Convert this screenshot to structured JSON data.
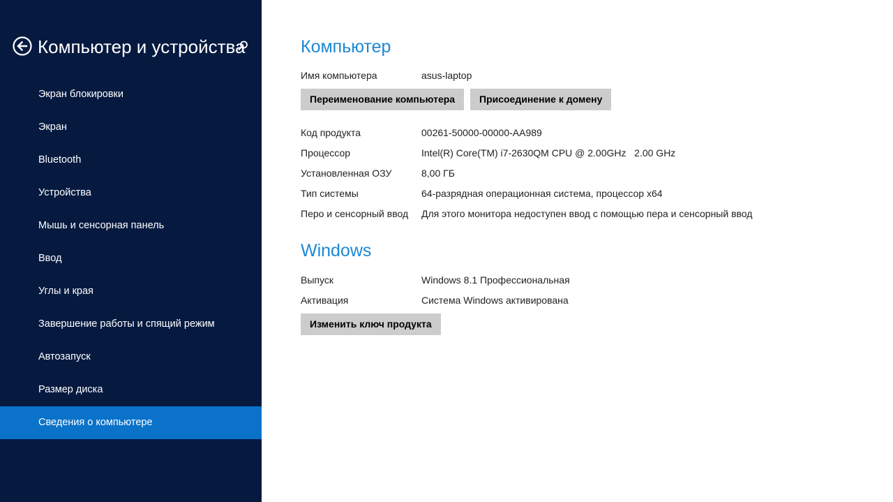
{
  "sidebar": {
    "title": "Компьютер и устройства",
    "back_icon": "back-arrow-icon",
    "search_icon": "search-icon",
    "items": [
      {
        "label": "Экран блокировки"
      },
      {
        "label": "Экран"
      },
      {
        "label": "Bluetooth"
      },
      {
        "label": "Устройства"
      },
      {
        "label": "Мышь и сенсорная панель"
      },
      {
        "label": "Ввод"
      },
      {
        "label": "Углы и края"
      },
      {
        "label": "Завершение работы и спящий режим"
      },
      {
        "label": "Автозапуск"
      },
      {
        "label": "Размер диска"
      },
      {
        "label": "Сведения о компьютере",
        "selected": true
      }
    ]
  },
  "computer": {
    "heading": "Компьютер",
    "name_label": "Имя компьютера",
    "name_value": "asus-laptop",
    "rename_button": "Переименование компьютера",
    "join_domain_button": "Присоединение к домену",
    "specs": [
      {
        "label": "Код продукта",
        "value": "00261-50000-00000-AA989"
      },
      {
        "label": "Процессор",
        "value": "Intel(R) Core(TM) i7-2630QM CPU @ 2.00GHz   2.00 GHz"
      },
      {
        "label": "Установленная ОЗУ",
        "value": "8,00 ГБ"
      },
      {
        "label": "Тип системы",
        "value": "64-разрядная операционная система, процессор x64"
      },
      {
        "label": "Перо и сенсорный ввод",
        "value": "Для этого монитора недоступен ввод с помощью пера и сенсорный ввод"
      }
    ]
  },
  "windows": {
    "heading": "Windows",
    "edition_label": "Выпуск",
    "edition_value": "Windows 8.1 Профессиональная",
    "activation_label": "Активация",
    "activation_value": "Система Windows активирована",
    "change_key_button": "Изменить ключ продукта"
  },
  "colors": {
    "sidebar_bg": "#061a40",
    "selected_item_bg": "#0b72c9",
    "accent_heading": "#1e88d2",
    "button_bg": "#cccccc"
  }
}
